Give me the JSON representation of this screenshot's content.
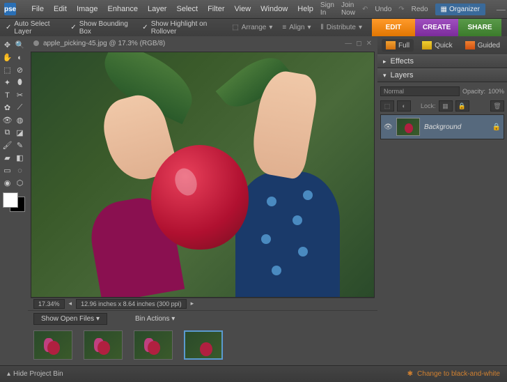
{
  "app": {
    "logo_text": "pse"
  },
  "menu": [
    "File",
    "Edit",
    "Image",
    "Enhance",
    "Layer",
    "Select",
    "Filter",
    "View",
    "Window",
    "Help"
  ],
  "top_right": {
    "sign_in": "Sign In",
    "join": "Join Now",
    "undo": "Undo",
    "redo": "Redo",
    "organizer": "Organizer"
  },
  "options": {
    "auto_select": "Auto Select Layer",
    "bounding": "Show Bounding Box",
    "highlight": "Show Highlight on Rollover",
    "arrange": "Arrange",
    "align": "Align",
    "distribute": "Distribute"
  },
  "mode_tabs": {
    "edit": "EDIT",
    "create": "CREATE",
    "share": "SHARE"
  },
  "view_modes": {
    "full": "Full",
    "quick": "Quick",
    "guided": "Guided"
  },
  "document": {
    "title": "apple_picking-45.jpg @ 17.3% (RGB/8)"
  },
  "status": {
    "zoom": "17.34%",
    "dims": "12.96 inches x 8.64 inches (300 ppi)"
  },
  "bin": {
    "show_open": "Show Open Files",
    "actions": "Bin Actions"
  },
  "panels": {
    "effects": "Effects",
    "layers": {
      "title": "Layers",
      "blend": "Normal",
      "opacity_label": "Opacity:",
      "opacity_val": "100%",
      "lock": "Lock:",
      "bg_name": "Background"
    }
  },
  "bottom": {
    "hide_bin": "Hide Project Bin",
    "bw": "Change to black-and-white"
  }
}
